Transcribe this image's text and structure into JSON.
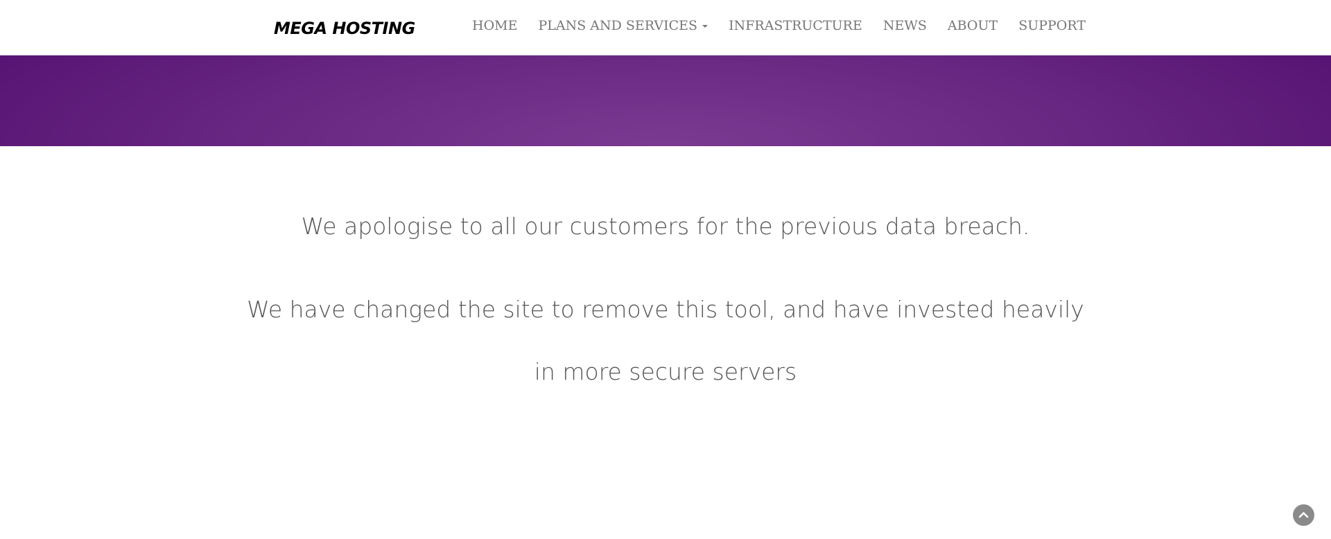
{
  "header": {
    "logo_text": "MEGA HOSTING",
    "nav": [
      {
        "label": "HOME"
      },
      {
        "label": "PLANS AND SERVICES",
        "has_dropdown": true
      },
      {
        "label": "INFRASTRUCTURE"
      },
      {
        "label": "NEWS"
      },
      {
        "label": "ABOUT"
      },
      {
        "label": "SUPPORT"
      }
    ]
  },
  "hero": {
    "colors": {
      "center": "#7b3a92",
      "edge": "#551070"
    }
  },
  "main": {
    "message_1": "We apologise to all our customers for the previous data breach.",
    "message_2": "We have changed the site to remove this tool, and have invested heavily",
    "message_3": "in more secure servers"
  },
  "scroll_top": {
    "icon": "chevron-up-icon",
    "color": "#8a8a8a"
  }
}
